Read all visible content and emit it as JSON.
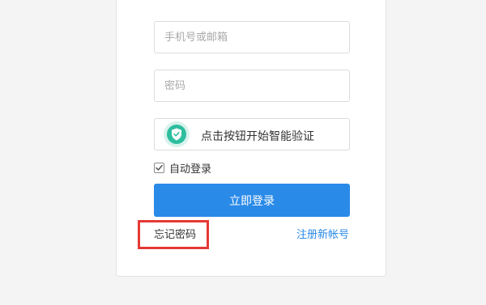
{
  "form": {
    "phone_placeholder": "手机号或邮箱",
    "password_placeholder": "密码",
    "captcha_label": "点击按钮开始智能验证",
    "auto_login_label": "自动登录",
    "auto_login_checked": true,
    "login_button": "立即登录",
    "forgot_password": "忘记密码",
    "register": "注册新帐号"
  },
  "icons": {
    "captcha": "shield-check-icon",
    "checkbox": "checkmark-icon"
  },
  "colors": {
    "primary": "#2a8ae8",
    "captcha_accent": "#2dbd9f",
    "highlight": "#e53935"
  }
}
